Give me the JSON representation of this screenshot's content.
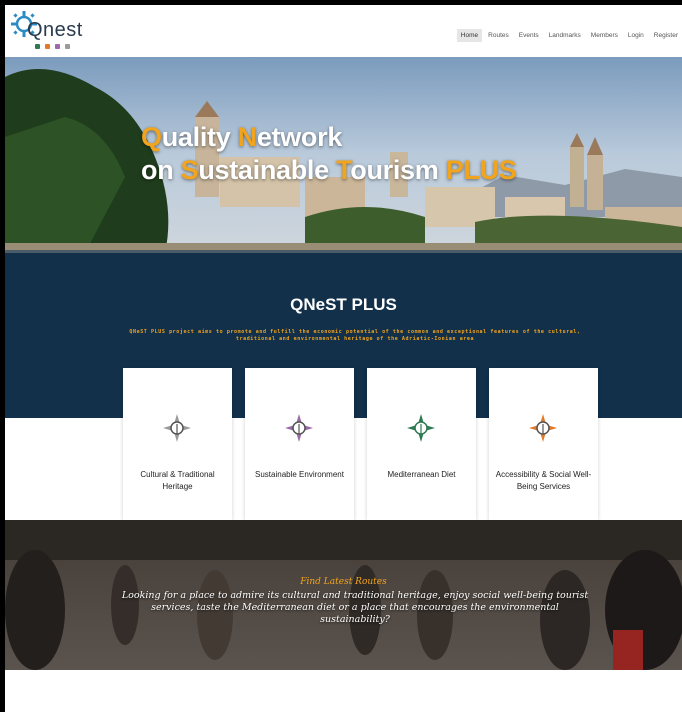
{
  "brand": {
    "name": "Qnest"
  },
  "nav": {
    "items": [
      {
        "label": "Home",
        "active": true
      },
      {
        "label": "Routes"
      },
      {
        "label": "Events"
      },
      {
        "label": "Landmarks"
      },
      {
        "label": "Members"
      },
      {
        "label": "Login"
      },
      {
        "label": "Register"
      }
    ]
  },
  "hero": {
    "line1_q": "Q",
    "line1_a": "uality ",
    "line1_n": "N",
    "line1_b": "etwork",
    "line2_a": "on ",
    "line2_s": "S",
    "line2_b": "ustainable ",
    "line2_t": "T",
    "line2_c": "ourism ",
    "line2_plus": "PLUS"
  },
  "intro": {
    "title": "QNeST PLUS",
    "text": "QNeST PLUS project aims to promote and fulfill the economic potential of the common and exceptional features of the cultural, traditional and environmental heritage of the Adriatic-Ionian area"
  },
  "cards": [
    {
      "label": "Cultural & Traditional Heritage",
      "icon": "compass-grey-icon",
      "color": "#9a9a9a"
    },
    {
      "label": "Sustainable Environment",
      "icon": "compass-purple-icon",
      "color": "#9b6aa8"
    },
    {
      "label": "Mediterranean Diet",
      "icon": "compass-green-icon",
      "color": "#2f7a52"
    },
    {
      "label": "Accessibility & Social Well-Being Services",
      "icon": "compass-orange-icon",
      "color": "#e07a2a"
    }
  ],
  "routes": {
    "heading": "Find Latest Routes",
    "text": "Looking for a place to admire its cultural and traditional heritage, enjoy social well-being tourist services, taste the Mediterranean diet or a place that encourages the environmental sustainability?"
  },
  "colors": {
    "accent": "#f2a41c",
    "band": "#12304a"
  }
}
